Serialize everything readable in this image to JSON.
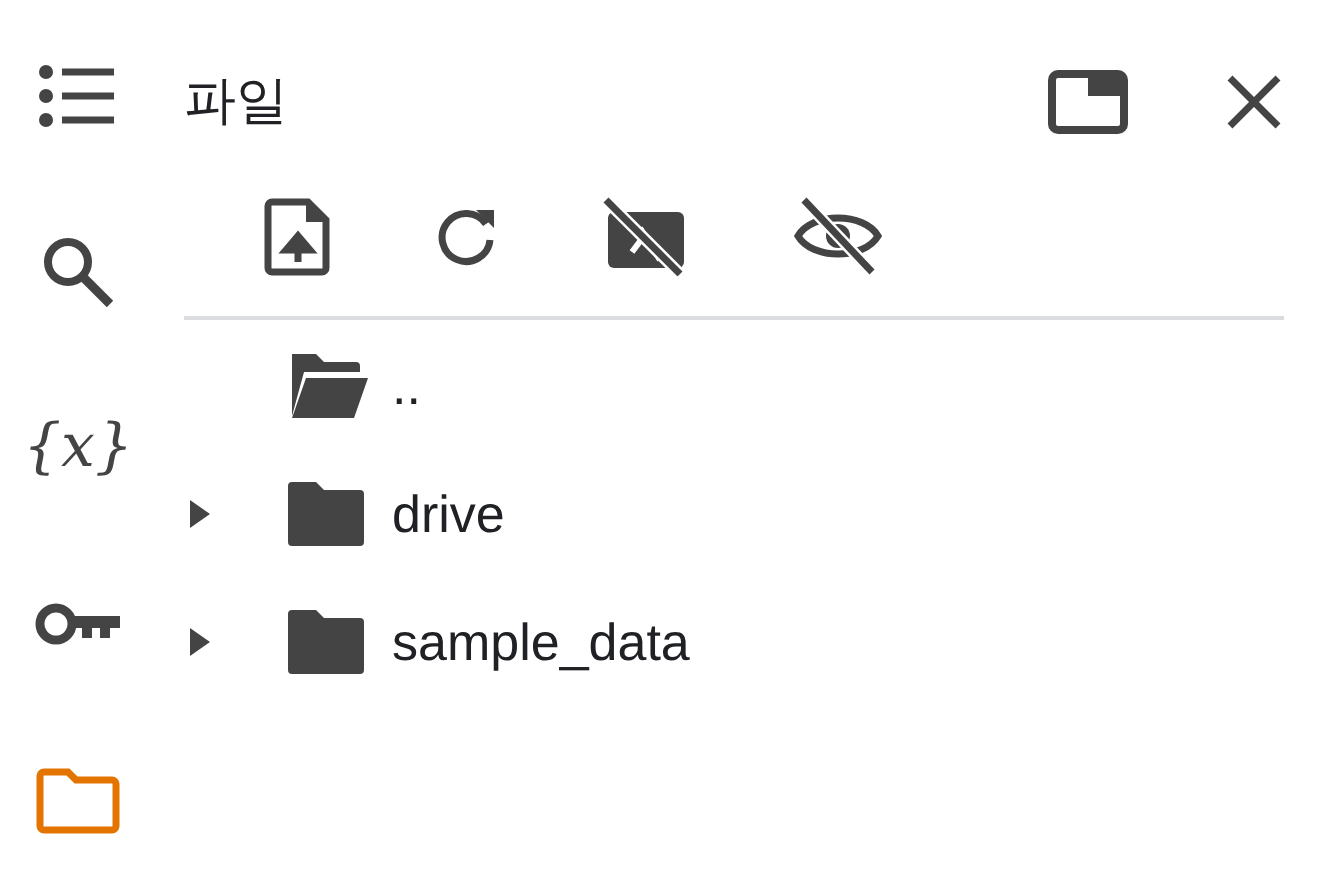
{
  "sidebar": {
    "items": [
      {
        "kind": "toc",
        "selected": false
      },
      {
        "kind": "search",
        "selected": false
      },
      {
        "kind": "variables",
        "glyph": "{x}",
        "selected": false
      },
      {
        "kind": "secrets",
        "selected": false
      },
      {
        "kind": "files",
        "selected": true
      }
    ]
  },
  "panel": {
    "title": "파일"
  },
  "files": [
    {
      "kind": "parent",
      "name": ".."
    },
    {
      "kind": "folder",
      "name": "drive",
      "expanded": false
    },
    {
      "kind": "folder",
      "name": "sample_data",
      "expanded": false
    }
  ]
}
